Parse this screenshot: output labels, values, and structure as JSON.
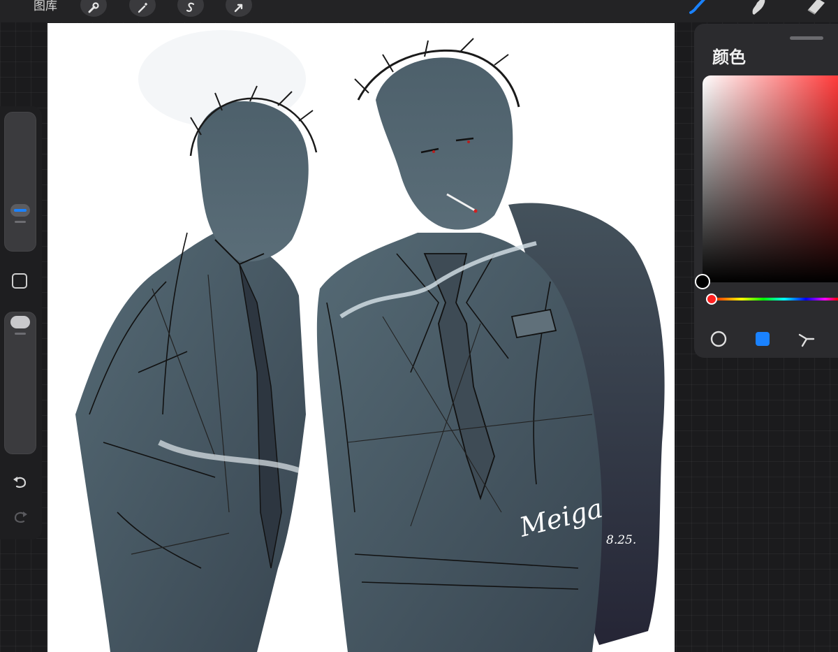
{
  "toolbar": {
    "gallery_label": "图库",
    "left_tools": [
      {
        "name": "actions",
        "icon": "wrench-icon"
      },
      {
        "name": "adjustments",
        "icon": "magic-wand-icon"
      },
      {
        "name": "selection",
        "icon": "selection-s-icon"
      },
      {
        "name": "transform",
        "icon": "arrow-cursor-icon"
      }
    ],
    "right_tools": [
      {
        "name": "brush",
        "icon": "brush-icon",
        "active": true,
        "color": "#1a82ff"
      },
      {
        "name": "smudge",
        "icon": "smudge-finger-icon",
        "active": false
      },
      {
        "name": "eraser",
        "icon": "eraser-icon",
        "active": false
      }
    ]
  },
  "sidebar": {
    "brush_size": 0.43,
    "opacity": 1.0,
    "tools": [
      "modify-square-icon",
      "undo-icon",
      "redo-icon"
    ]
  },
  "canvas": {
    "signature": "Meiga",
    "date_mark": "8.25."
  },
  "color_panel": {
    "title": "颜色",
    "current_color": "#000000",
    "hue_color": "#ff2020",
    "hue": 0.0,
    "modes": [
      {
        "name": "disc",
        "icon": "circle-outline-icon",
        "active": false
      },
      {
        "name": "classic",
        "icon": "square-filled-icon",
        "active": true,
        "color": "#1a82ff"
      },
      {
        "name": "harmony",
        "icon": "harmony-icon",
        "active": false
      }
    ]
  }
}
